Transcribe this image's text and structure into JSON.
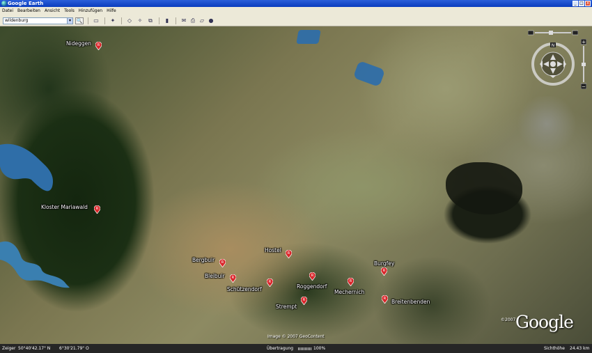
{
  "window": {
    "title": "Google Earth",
    "controls": [
      "_",
      "□",
      "x"
    ]
  },
  "menu": [
    "Datei",
    "Bearbeiten",
    "Ansicht",
    "Tools",
    "Hinzufügen",
    "Hilfe"
  ],
  "search": {
    "value": "wildenburg"
  },
  "places": [
    {
      "name": "Nideggen"
    },
    {
      "name": "Kloster Mariawald"
    },
    {
      "name": "Hostel"
    },
    {
      "name": "Bergbuir"
    },
    {
      "name": "Bleibuir"
    },
    {
      "name": "Schützendorf"
    },
    {
      "name": "Roggendorf"
    },
    {
      "name": "Mechernich"
    },
    {
      "name": "Burgfey"
    },
    {
      "name": "Strempt"
    },
    {
      "name": "Breitenbenden"
    }
  ],
  "map": {
    "image_credit": "Image © 2007 GeoContent",
    "logo_copyright": "©2007",
    "logo": "Google",
    "nav_north_label": "N"
  },
  "status": {
    "pointer_label": "Zeiger",
    "pointer_lat": "50°40'42.17\" N",
    "pointer_lon": "6°30'21.79\" O",
    "streaming_label": "Übertragung",
    "streaming_percent": "100%",
    "eye_alt_label": "Sichthöhe",
    "eye_alt_value": "24.43 km"
  },
  "colors": {
    "pin": "#d9262a",
    "title_bar": "#0a3cbe",
    "water": "#2f6ea8"
  }
}
